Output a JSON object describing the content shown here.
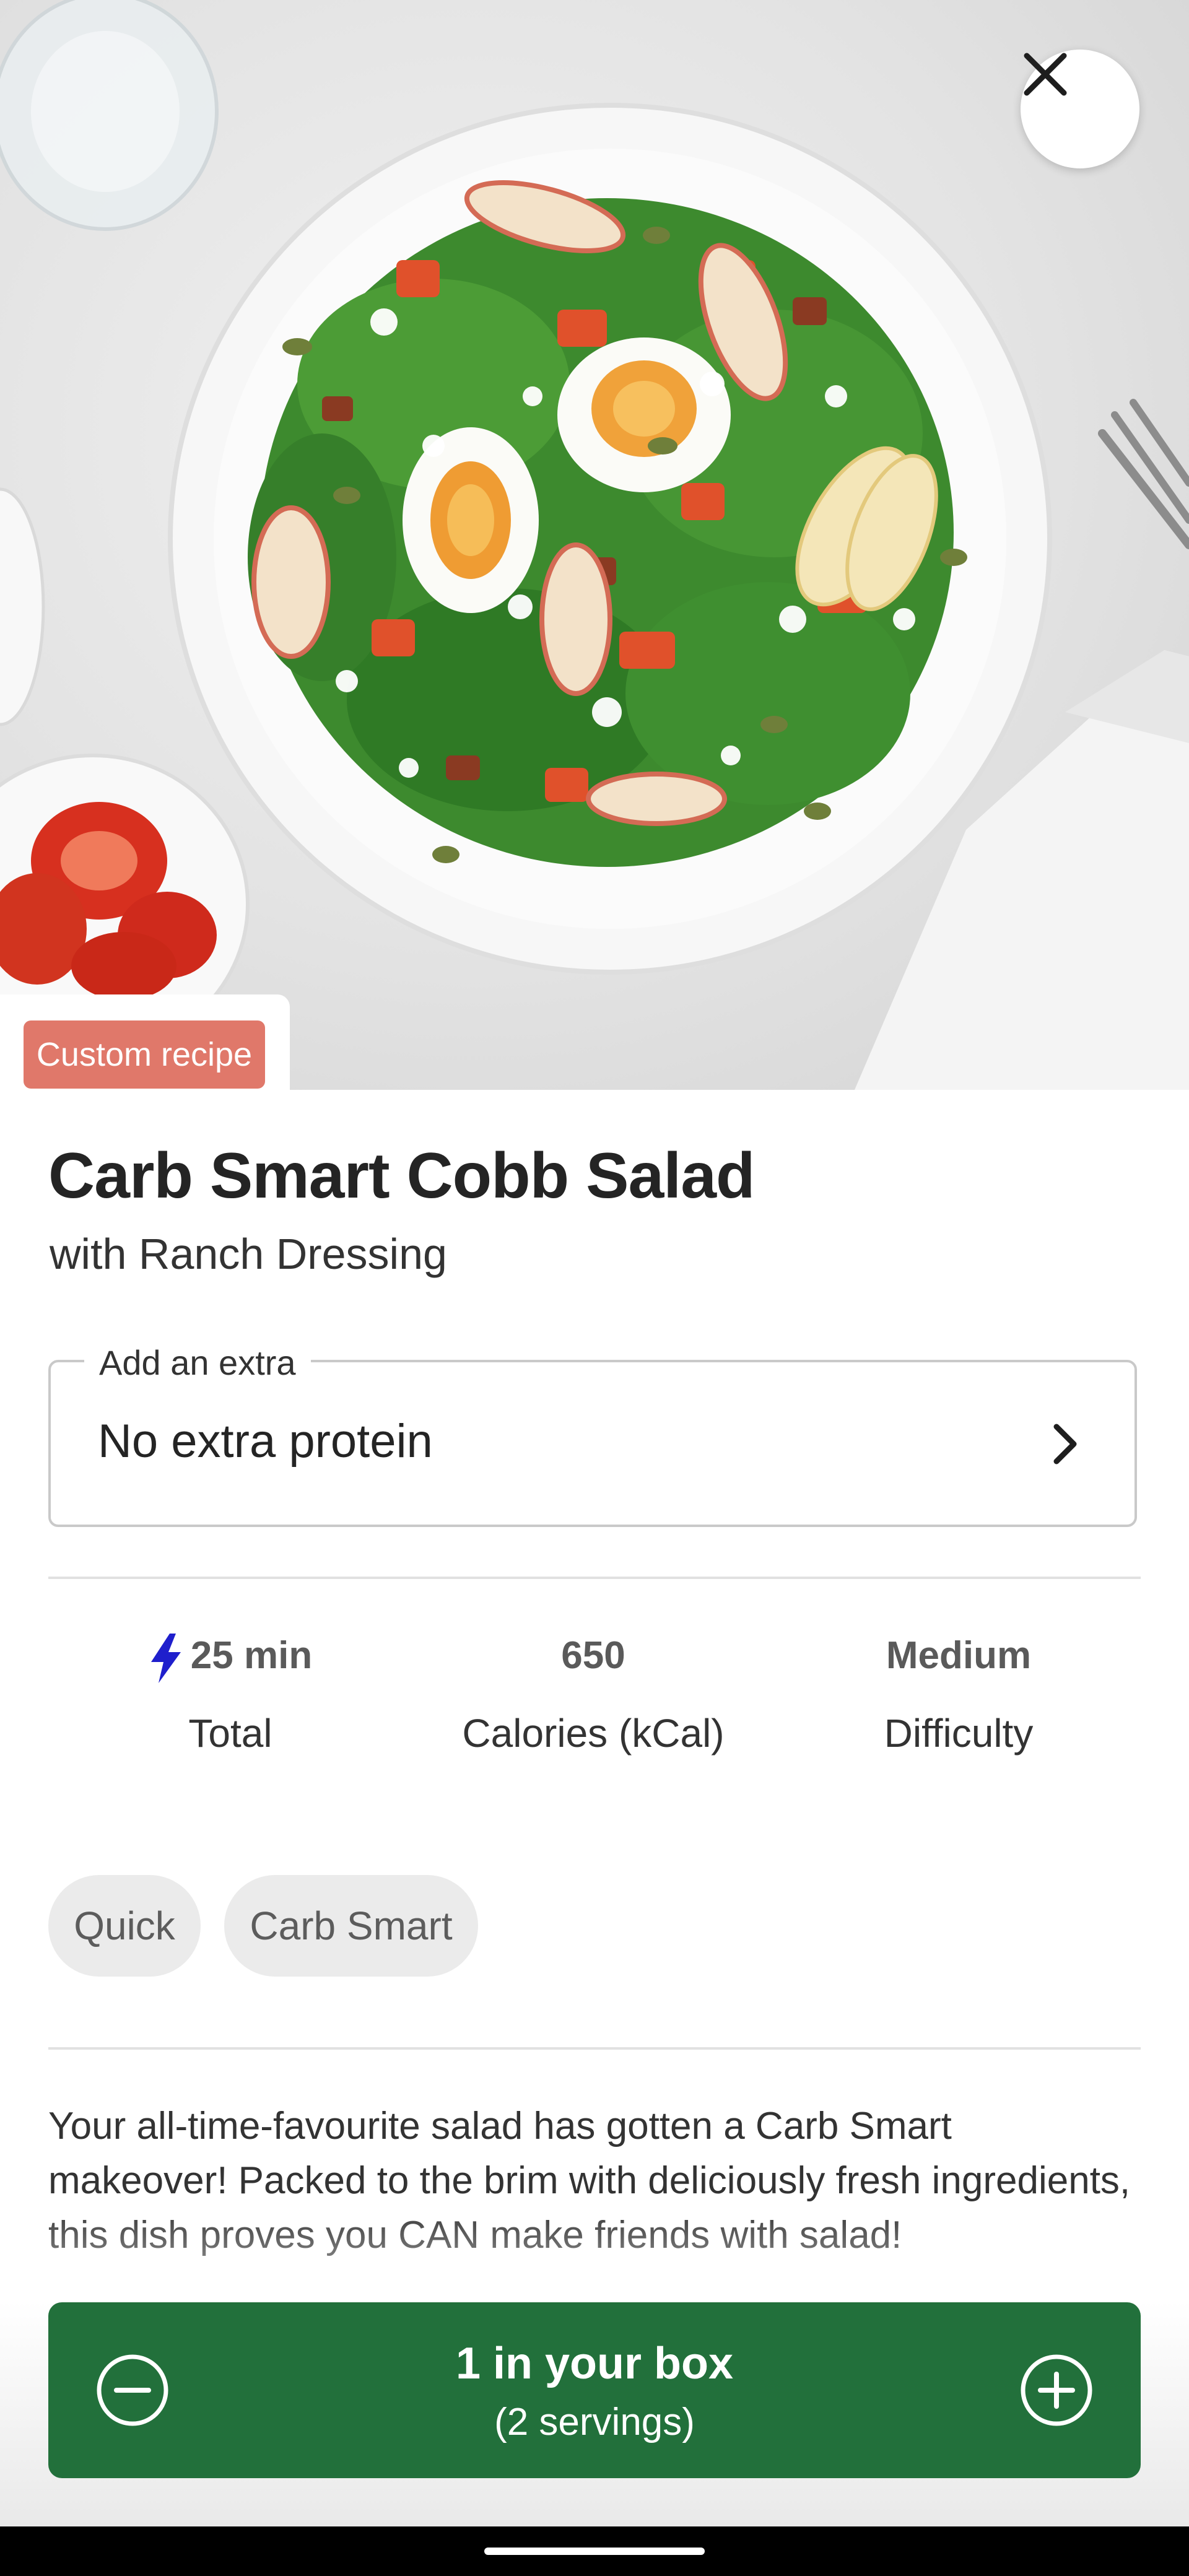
{
  "hero": {
    "image_description_icon": "salad-photo",
    "close_icon": "close-icon",
    "badge_label": "Custom recipe"
  },
  "recipe": {
    "title": "Carb Smart Cobb Salad",
    "subtitle": "with Ranch Dressing"
  },
  "extra": {
    "legend": "Add an extra",
    "value": "No extra protein"
  },
  "stats": [
    {
      "value": "25 min",
      "label": "Total",
      "icon": "bolt-icon"
    },
    {
      "value": "650",
      "label": "Calories (kCal)"
    },
    {
      "value": "Medium",
      "label": "Difficulty"
    }
  ],
  "tags": [
    "Quick",
    "Carb Smart"
  ],
  "description": "Your all-time-favourite salad has gotten a Carb Smart makeover! Packed to the brim with deliciously fresh ingredients, this dish proves you CAN make friends with salad!",
  "cart": {
    "main": "1 in your box",
    "sub": "(2 servings)"
  },
  "colors": {
    "badge": "#e0786a",
    "cart_green": "#22703b",
    "bolt": "#1f1fcc"
  }
}
